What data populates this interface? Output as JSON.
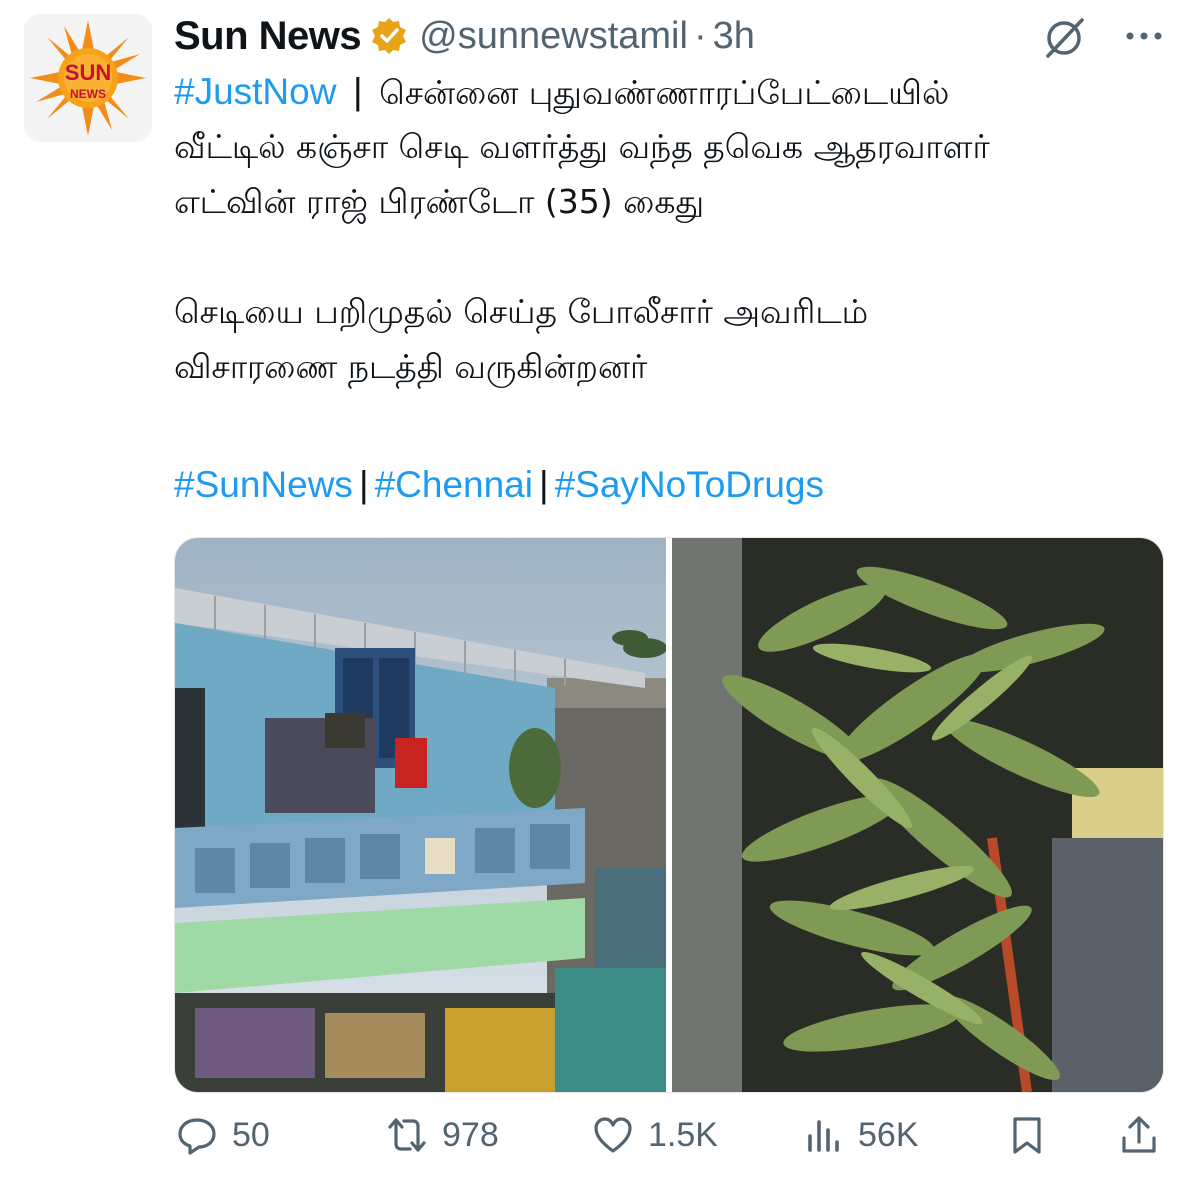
{
  "tweet": {
    "author_name": "Sun News",
    "handle": "@sunnewstamil",
    "separator": "·",
    "time": "3h",
    "avatar_text": "SUN",
    "avatar_subtext": "NEWS",
    "lead_tag": "#JustNow",
    "lead_sep": "|",
    "line1": "சென்னை புதுவண்ணாரப்பேட்டையில்",
    "line2": "வீட்டில் கஞ்சா செடி வளர்த்து வந்த தவெக ஆதரவாளர்",
    "line3": "எட்வின் ராஜ் பிரண்டோ (35) கைது",
    "line4": "செடியை பறிமுதல் செய்த போலீசார் அவரிடம்",
    "line5": "விசாரணை நடத்தி வருகின்றனர்",
    "hashtags": [
      "#SunNews",
      "#Chennai",
      "#SayNoToDrugs"
    ],
    "hashtag_sep": "|"
  },
  "actions": {
    "replies": "50",
    "reposts": "978",
    "likes": "1.5K",
    "views": "56K"
  },
  "icons": [
    "verified-badge-icon",
    "grok-icon",
    "more-icon",
    "reply-icon",
    "repost-icon",
    "like-icon",
    "views-icon",
    "bookmark-icon",
    "share-icon"
  ],
  "colors": {
    "link": "#1d9bf0",
    "muted": "#536471",
    "text": "#0f1419",
    "verified": "#e8a317"
  }
}
